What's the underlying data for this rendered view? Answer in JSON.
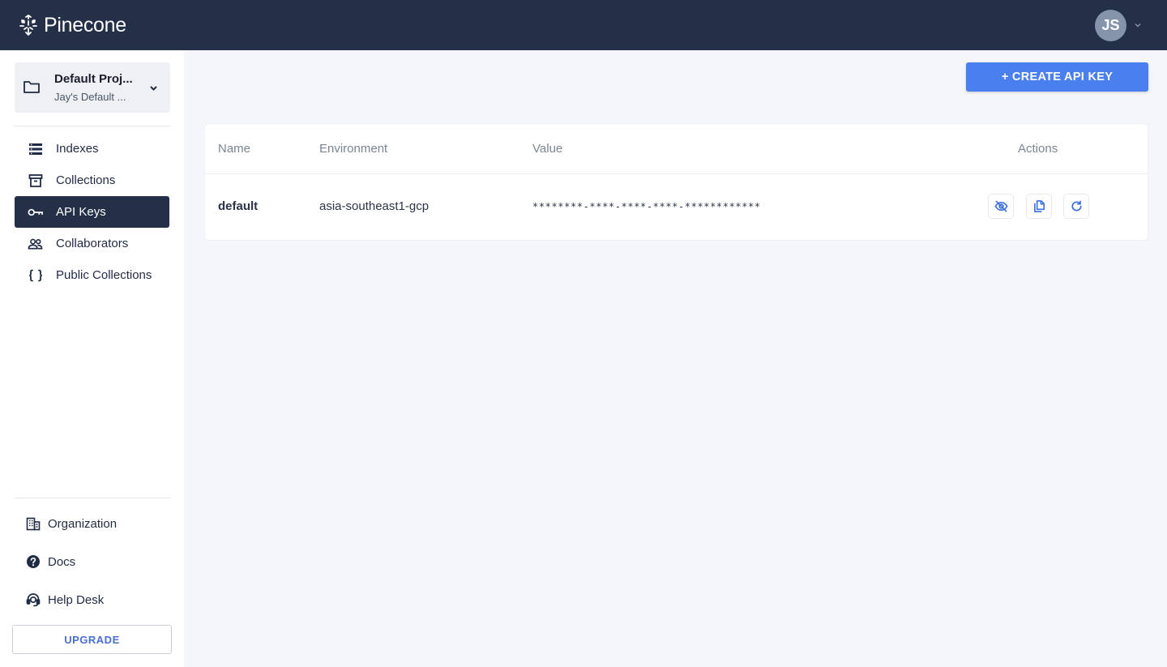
{
  "header": {
    "brand": "Pinecone",
    "avatar_initials": "JS"
  },
  "sidebar": {
    "project": {
      "name": "Default Proj...",
      "org": "Jay's Default ..."
    },
    "nav": [
      {
        "label": "Indexes",
        "icon": "list-icon"
      },
      {
        "label": "Collections",
        "icon": "archive-icon"
      },
      {
        "label": "API Keys",
        "icon": "key-icon",
        "active": true
      },
      {
        "label": "Collaborators",
        "icon": "people-icon"
      },
      {
        "label": "Public Collections",
        "icon": "braces-icon"
      }
    ],
    "bottom": [
      {
        "label": "Organization",
        "icon": "building-icon"
      },
      {
        "label": "Docs",
        "icon": "help-circle-icon"
      },
      {
        "label": "Help Desk",
        "icon": "support-agent-icon"
      }
    ],
    "upgrade_label": "UPGRADE"
  },
  "main": {
    "create_button": "+ CREATE API KEY",
    "table": {
      "columns": [
        "Name",
        "Environment",
        "Value",
        "Actions"
      ],
      "rows": [
        {
          "name": "default",
          "environment": "asia-southeast1-gcp",
          "value": "********-****-****-****-************",
          "actions": [
            "eye-off-icon",
            "copy-icon",
            "refresh-icon"
          ]
        }
      ]
    }
  },
  "colors": {
    "topbar": "#233048",
    "accent": "#4a7ff0",
    "active_nav": "#233048",
    "action_icon": "#3b6fe0"
  }
}
